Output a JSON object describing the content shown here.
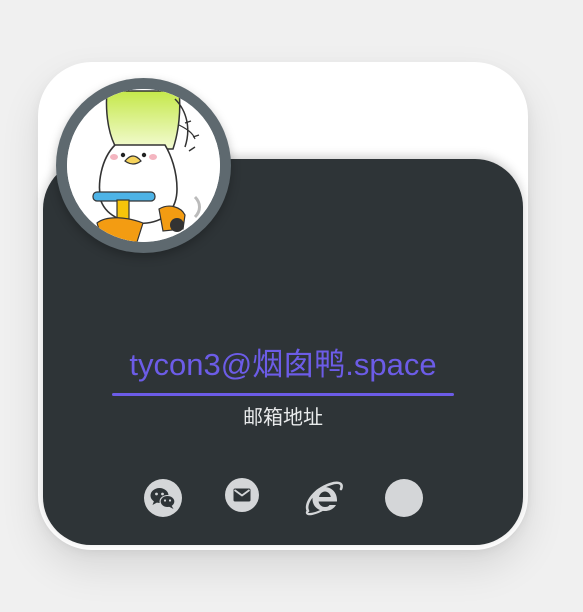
{
  "profile": {
    "avatar_icon": "duck-on-scooter-avatar"
  },
  "contact": {
    "email_text": "tycon3@烟囱鸭.space",
    "email_caption": "邮箱地址",
    "link_color": "#6c5ce7"
  },
  "colors": {
    "page_background": "#f0f0f0",
    "card_background": "#ffffff",
    "panel_background": "#2e3437",
    "avatar_ring": "#5e696f",
    "social_icon": "#d4d6d8"
  },
  "social_links": [
    {
      "icon": "wechat-icon"
    },
    {
      "icon": "mail-icon"
    },
    {
      "icon": "internet-explorer-icon"
    },
    {
      "icon": "blank-circle-icon"
    }
  ]
}
